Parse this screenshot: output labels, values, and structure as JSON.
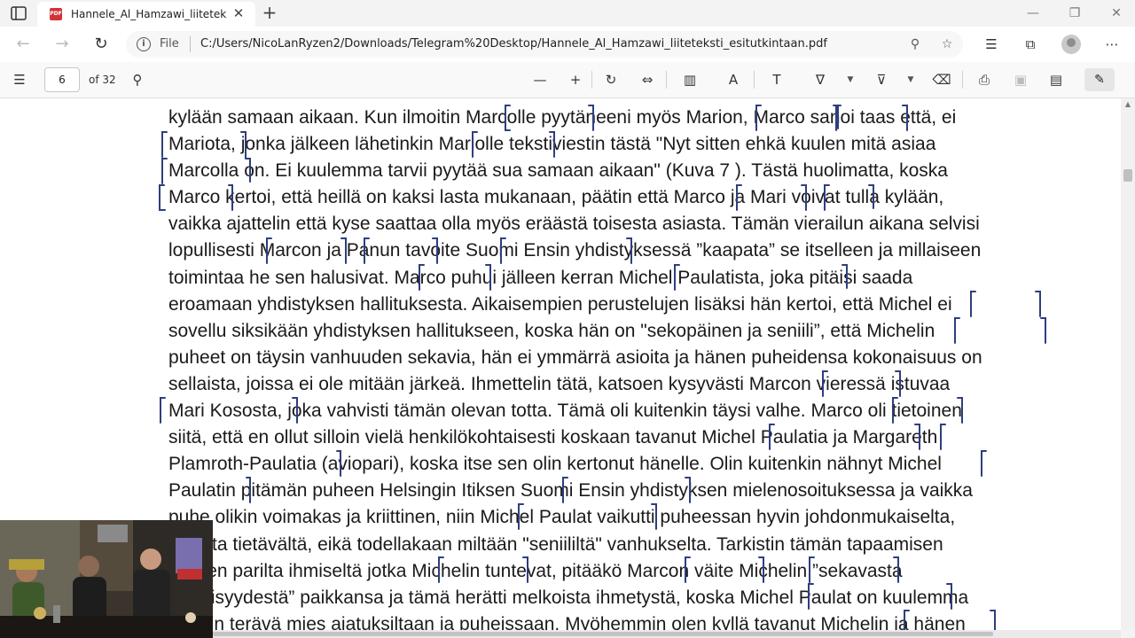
{
  "tab": {
    "title": "Hannele_Al_Hamzawi_liiteteksti_"
  },
  "address": {
    "scheme_label": "File",
    "url": "C:/Users/NicoLanRyzen2/Downloads/Telegram%20Desktop/Hannele_Al_Hamzawi_liiteteksti_esitutkintaan.pdf"
  },
  "pdf": {
    "current_page": "6",
    "page_count_label": "of 32"
  },
  "document": {
    "lines": [
      "kylään samaan aikaan.  Kun ilmoitin Marcolle pyytäneeni myös Marion, Marco sanoi  taas että, ei",
      "Mariota, jonka jälkeen lähetinkin Mariolle tekstiviestin tästä \"Nyt sitten ehkä kuulen mitä asiaa",
      "Marcolla on. Ei kuulemma tarvii pyytää sua samaan aikaan\"  (Kuva 7 ). Tästä huolimatta,  koska",
      "Marco kertoi, että heillä on kaksi lasta mukanaan, päätin että Marco ja Mari voivat tulla kylään,",
      "vaikka ajattelin että kyse saattaa olla myös eräästä toisesta asiasta. Tämän vierailun aikana selvisi",
      "lopullisesti Marcon ja Panun tavoite Suomi Ensin yhdistyksessä ”kaapata” se itselleen ja millaiseen",
      "toimintaa he sen halusivat. Marco puhui jälleen kerran Michel Paulatista, joka pitäisi saada",
      "eroamaan yhdistyksen hallituksesta. Aikaisempien perustelujen lisäksi hän kertoi, että Michel ei",
      "sovellu siksikään yhdistyksen hallitukseen, koska hän on \"sekopäinen ja seniili”, että Michelin",
      "puheet on täysin vanhuuden sekavia, hän ei ymmärrä asioita ja hänen puheidensa kokonaisuus on",
      "sellaista, joissa ei ole mitään järkeä. Ihmettelin tätä, katsoen kysyvästi Marcon vieressä istuvaa",
      "Mari Kososta, joka vahvisti tämän olevan totta. Tämä oli kuitenkin täysi valhe. Marco oli tietoinen",
      "siitä, että en ollut silloin vielä henkilökohtaisesti koskaan tavanut Michel Paulatia ja Margareth",
      "Plamroth-Paulatia (aviopari), koska itse sen olin kertonut hänelle. Olin kuitenkin nähnyt Michel",
      "Paulatin pitämän puheen Helsingin Itiksen Suomi Ensin yhdistyksen mielenosoituksessa ja vaikka",
      "puhe olikin voimakas ja kriittinen, niin Michel Paulat vaikutti puheessan hyvin johdonmukaiselta,",
      "asiasta tietävältä, eikä todellakaan miltään \"seniililtä\" vanhukselta. Tarkistin tämän tapaamisen",
      "jälkeen parilta ihmiseltä jotka Michelin tuntevat, pitääkö Marcon väite Michelin ”sekavasta",
      "seniilisyydestä” paikkansa ja tämä herätti melkoista ihmetystä, koska Michel Paulat on kuulemma",
      "erittäin terävä mies ajatuksiltaan ja puheissaan. Myöhemmin olen kyllä tavanut Michelin ja hänen"
    ]
  },
  "colors": {
    "annotation_ink": "#2e3e7e",
    "tab_bg": "#ffffff",
    "chrome_bg": "#f3f3f3",
    "pdf_icon": "#d13438"
  },
  "icons": [
    "tab-actions-icon",
    "pdf-favicon",
    "close-icon",
    "plus-icon",
    "minimize-icon",
    "restore-icon",
    "back-icon",
    "forward-icon",
    "refresh-icon",
    "info-icon",
    "zoom-icon",
    "favorite-add-icon",
    "favorites-icon",
    "collections-icon",
    "profile-avatar",
    "more-icon",
    "contents-icon",
    "search-icon",
    "zoom-out-icon",
    "zoom-in-icon",
    "rotate-icon",
    "fit-width-icon",
    "page-view-icon",
    "read-aloud-icon",
    "text-box-icon",
    "draw-icon",
    "highlight-icon",
    "eraser-icon",
    "print-icon",
    "save-icon",
    "save-as-icon",
    "pin-icon"
  ]
}
